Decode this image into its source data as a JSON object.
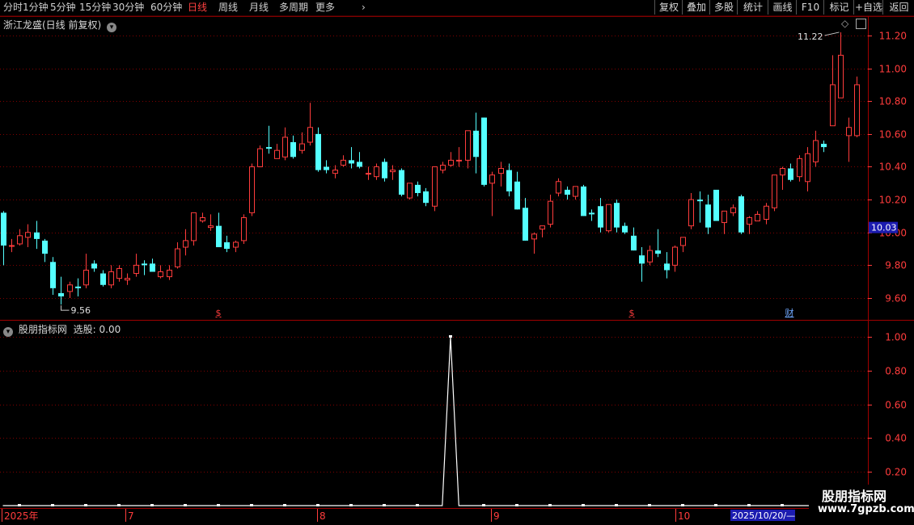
{
  "toolbar": {
    "periods": [
      {
        "label": "分时",
        "active": false
      },
      {
        "label": "1分钟",
        "active": false
      },
      {
        "label": "5分钟",
        "active": false
      },
      {
        "label": "15分钟",
        "active": false
      },
      {
        "label": "30分钟",
        "active": false
      },
      {
        "label": "60分钟",
        "active": false
      },
      {
        "label": "日线",
        "active": true
      },
      {
        "label": "周线",
        "active": false
      },
      {
        "label": "月线",
        "active": false
      },
      {
        "label": "多周期",
        "active": false
      },
      {
        "label": "更多",
        "active": false
      }
    ],
    "buttons": [
      "复权",
      "叠加",
      "多股",
      "统计",
      "画线",
      "F10",
      "标记",
      "+自选",
      "返回"
    ]
  },
  "main_chart": {
    "title": "浙江龙盛(日线 前复权)",
    "high_label": "11.22",
    "low_label": "9.56",
    "current_price": "10.03",
    "markers": [
      "$",
      "$",
      "财"
    ]
  },
  "indicator": {
    "title": "股朋指标网",
    "value_label": "选股: 0.00"
  },
  "dates": {
    "labels": [
      "2025年",
      "7",
      "8",
      "9",
      "10"
    ],
    "current": "2025/10/20/—"
  },
  "watermark": {
    "line1": "股朋指标网",
    "line2": "www.7gpzb.com"
  },
  "colors": {
    "up": "#ff3c3c",
    "down": "#54ffff",
    "grid": "#800000",
    "axis_text": "#ff3c3c",
    "background": "#000000"
  },
  "chart_data": [
    {
      "type": "candlestick",
      "title": "浙江龙盛(日线 前复权)",
      "ylim": [
        9.5,
        11.3
      ],
      "yticks": [
        9.6,
        9.8,
        10.0,
        10.2,
        10.4,
        10.6,
        10.8,
        11.0,
        11.2
      ],
      "ohlc": [
        [
          10.12,
          10.13,
          9.8,
          9.92
        ],
        [
          9.92,
          9.96,
          9.88,
          9.92
        ],
        [
          9.93,
          10.02,
          9.92,
          9.98
        ],
        [
          9.97,
          10.05,
          9.91,
          10.0
        ],
        [
          10.0,
          10.07,
          9.9,
          9.96
        ],
        [
          9.95,
          9.96,
          9.82,
          9.87
        ],
        [
          9.82,
          9.85,
          9.62,
          9.66
        ],
        [
          9.63,
          9.73,
          9.56,
          9.61
        ],
        [
          9.64,
          9.7,
          9.6,
          9.68
        ],
        [
          9.67,
          9.72,
          9.61,
          9.66
        ],
        [
          9.68,
          9.87,
          9.66,
          9.77
        ],
        [
          9.81,
          9.83,
          9.76,
          9.78
        ],
        [
          9.75,
          9.77,
          9.67,
          9.68
        ],
        [
          9.68,
          9.8,
          9.66,
          9.76
        ],
        [
          9.72,
          9.8,
          9.7,
          9.78
        ],
        [
          9.71,
          9.75,
          9.68,
          9.72
        ],
        [
          9.75,
          9.87,
          9.73,
          9.8
        ],
        [
          9.81,
          9.83,
          9.74,
          9.8
        ],
        [
          9.81,
          9.84,
          9.76,
          9.76
        ],
        [
          9.73,
          9.8,
          9.72,
          9.76
        ],
        [
          9.73,
          9.8,
          9.71,
          9.77
        ],
        [
          9.79,
          9.94,
          9.78,
          9.9
        ],
        [
          9.91,
          10.02,
          9.86,
          9.95
        ],
        [
          9.95,
          10.12,
          9.92,
          10.12
        ],
        [
          10.07,
          10.12,
          10.06,
          10.09
        ],
        [
          10.03,
          10.11,
          10.01,
          10.04
        ],
        [
          10.04,
          10.12,
          9.91,
          9.91
        ],
        [
          9.94,
          9.98,
          9.88,
          9.9
        ],
        [
          9.91,
          9.95,
          9.88,
          9.94
        ],
        [
          9.95,
          10.11,
          9.93,
          10.09
        ],
        [
          10.12,
          10.42,
          10.1,
          10.4
        ],
        [
          10.4,
          10.53,
          10.4,
          10.51
        ],
        [
          10.52,
          10.65,
          10.48,
          10.51
        ],
        [
          10.45,
          10.54,
          10.45,
          10.5
        ],
        [
          10.46,
          10.64,
          10.44,
          10.58
        ],
        [
          10.55,
          10.59,
          10.45,
          10.46
        ],
        [
          10.5,
          10.61,
          10.48,
          10.54
        ],
        [
          10.55,
          10.79,
          10.53,
          10.64
        ],
        [
          10.6,
          10.64,
          10.37,
          10.38
        ],
        [
          10.4,
          10.44,
          10.36,
          10.38
        ],
        [
          10.36,
          10.41,
          10.33,
          10.38
        ],
        [
          10.41,
          10.47,
          10.4,
          10.44
        ],
        [
          10.44,
          10.52,
          10.39,
          10.42
        ],
        [
          10.43,
          10.49,
          10.39,
          10.4
        ],
        [
          10.36,
          10.4,
          10.32,
          10.36
        ],
        [
          10.34,
          10.42,
          10.32,
          10.4
        ],
        [
          10.43,
          10.45,
          10.31,
          10.33
        ],
        [
          10.37,
          10.41,
          10.32,
          10.38
        ],
        [
          10.38,
          10.39,
          10.22,
          10.23
        ],
        [
          10.21,
          10.29,
          10.2,
          10.3
        ],
        [
          10.29,
          10.31,
          10.22,
          10.24
        ],
        [
          10.25,
          10.27,
          10.16,
          10.18
        ],
        [
          10.16,
          10.4,
          10.13,
          10.4
        ],
        [
          10.38,
          10.43,
          10.36,
          10.41
        ],
        [
          10.41,
          10.49,
          10.4,
          10.44
        ],
        [
          10.44,
          10.52,
          10.4,
          10.44
        ],
        [
          10.44,
          10.53,
          10.39,
          10.62
        ],
        [
          10.62,
          10.73,
          10.36,
          10.46
        ],
        [
          10.7,
          10.7,
          10.28,
          10.29
        ],
        [
          10.3,
          10.37,
          10.1,
          10.35
        ],
        [
          10.36,
          10.43,
          10.28,
          10.39
        ],
        [
          10.38,
          10.42,
          10.22,
          10.25
        ],
        [
          10.31,
          10.37,
          10.14,
          10.14
        ],
        [
          10.15,
          10.21,
          9.95,
          9.95
        ],
        [
          9.96,
          10.0,
          9.87,
          9.99
        ],
        [
          10.02,
          10.04,
          9.97,
          10.04
        ],
        [
          10.05,
          10.23,
          10.03,
          10.19
        ],
        [
          10.24,
          10.33,
          10.22,
          10.31
        ],
        [
          10.26,
          10.28,
          10.2,
          10.23
        ],
        [
          10.22,
          10.27,
          10.2,
          10.28
        ],
        [
          10.28,
          10.29,
          10.1,
          10.1
        ],
        [
          10.12,
          10.14,
          10.07,
          10.11
        ],
        [
          10.16,
          10.21,
          10.0,
          10.03
        ],
        [
          10.01,
          10.14,
          10.0,
          10.17
        ],
        [
          10.18,
          10.2,
          10.0,
          10.03
        ],
        [
          10.04,
          10.06,
          9.99,
          10.0
        ],
        [
          9.98,
          10.03,
          9.89,
          9.89
        ],
        [
          9.86,
          9.91,
          9.7,
          9.81
        ],
        [
          9.82,
          9.92,
          9.8,
          9.89
        ],
        [
          9.89,
          10.02,
          9.85,
          9.87
        ],
        [
          9.81,
          9.88,
          9.72,
          9.77
        ],
        [
          9.8,
          9.92,
          9.76,
          9.91
        ],
        [
          9.92,
          9.95,
          9.88,
          9.97
        ],
        [
          10.04,
          10.24,
          10.02,
          10.2
        ],
        [
          10.2,
          10.25,
          10.06,
          10.19
        ],
        [
          10.17,
          10.23,
          9.99,
          10.03
        ],
        [
          10.26,
          10.26,
          10.07,
          10.07
        ],
        [
          10.06,
          10.13,
          9.99,
          10.13
        ],
        [
          10.12,
          10.17,
          10.1,
          10.15
        ],
        [
          10.22,
          10.23,
          9.99,
          10.0
        ],
        [
          10.05,
          10.1,
          9.99,
          10.09
        ],
        [
          10.07,
          10.13,
          10.07,
          10.11
        ],
        [
          10.08,
          10.18,
          10.05,
          10.16
        ],
        [
          10.15,
          10.35,
          10.13,
          10.35
        ],
        [
          10.35,
          10.4,
          10.26,
          10.39
        ],
        [
          10.39,
          10.42,
          10.31,
          10.32
        ],
        [
          10.34,
          10.47,
          10.31,
          10.45
        ],
        [
          10.31,
          10.52,
          10.25,
          10.48
        ],
        [
          10.43,
          10.62,
          10.4,
          10.56
        ],
        [
          10.54,
          10.56,
          10.49,
          10.52
        ],
        [
          10.65,
          11.08,
          10.65,
          10.9
        ],
        [
          10.82,
          11.22,
          10.82,
          11.08
        ],
        [
          10.59,
          10.7,
          10.43,
          10.64
        ],
        [
          10.59,
          10.95,
          10.58,
          10.9
        ]
      ]
    },
    {
      "type": "line",
      "title": "股朋指标网",
      "series": [
        {
          "name": "选股",
          "values": [
            0,
            0,
            0,
            0,
            0,
            0,
            0,
            0,
            0,
            0,
            0,
            0,
            0,
            0,
            0,
            0,
            0,
            0,
            0,
            0,
            0,
            0,
            0,
            0,
            0,
            0,
            0,
            0,
            0,
            0,
            0,
            0,
            0,
            0,
            0,
            0,
            0,
            0,
            0,
            0,
            0,
            0,
            0,
            0,
            0,
            0,
            0,
            0,
            0,
            0,
            0,
            0,
            0,
            0,
            1,
            0,
            0,
            0,
            0,
            0,
            0,
            0,
            0,
            0,
            0,
            0,
            0,
            0,
            0,
            0,
            0,
            0,
            0,
            0,
            0,
            0,
            0,
            0,
            0,
            0,
            0,
            0,
            0,
            0,
            0,
            0,
            0,
            0,
            0,
            0,
            0,
            0,
            0,
            0,
            0,
            0,
            0,
            0,
            0,
            0,
            0,
            0,
            0,
            0
          ]
        }
      ],
      "ylim": [
        0,
        1.05
      ],
      "yticks": [
        0.2,
        0.4,
        0.6,
        0.8,
        1.0
      ]
    }
  ]
}
